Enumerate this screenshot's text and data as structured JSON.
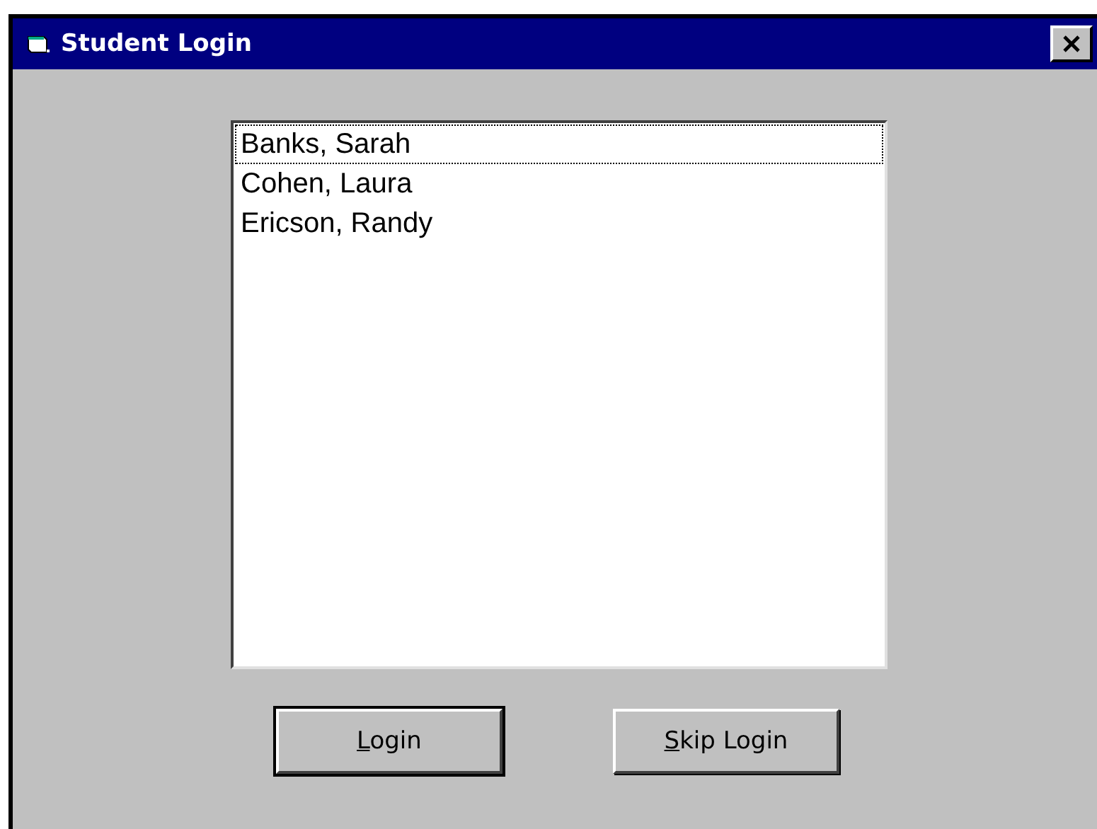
{
  "window": {
    "title": "Student Login"
  },
  "students": [
    {
      "name": "Banks, Sarah",
      "selected": false,
      "focused": true
    },
    {
      "name": "Cohen, Laura",
      "selected": false,
      "focused": false
    },
    {
      "name": "Ericson, Randy",
      "selected": false,
      "focused": false
    }
  ],
  "buttons": [
    {
      "label": "Login",
      "default": true,
      "underline_first": true
    },
    {
      "label": "Skip Login",
      "default": false,
      "underline_first": true
    }
  ]
}
